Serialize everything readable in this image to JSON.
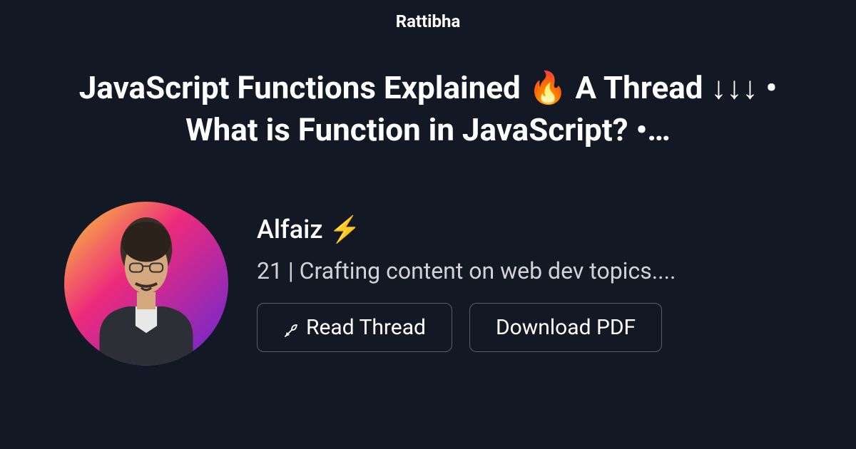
{
  "site": {
    "title": "Rattibha"
  },
  "thread": {
    "title": "JavaScript Functions Explained 🔥 A Thread ↓↓↓ • What is Function in JavaScript? •…"
  },
  "author": {
    "name": "Alfaiz ⚡",
    "bio": "21 | Crafting content on web dev topics...."
  },
  "buttons": {
    "read": "Read Thread",
    "download": "Download PDF"
  }
}
